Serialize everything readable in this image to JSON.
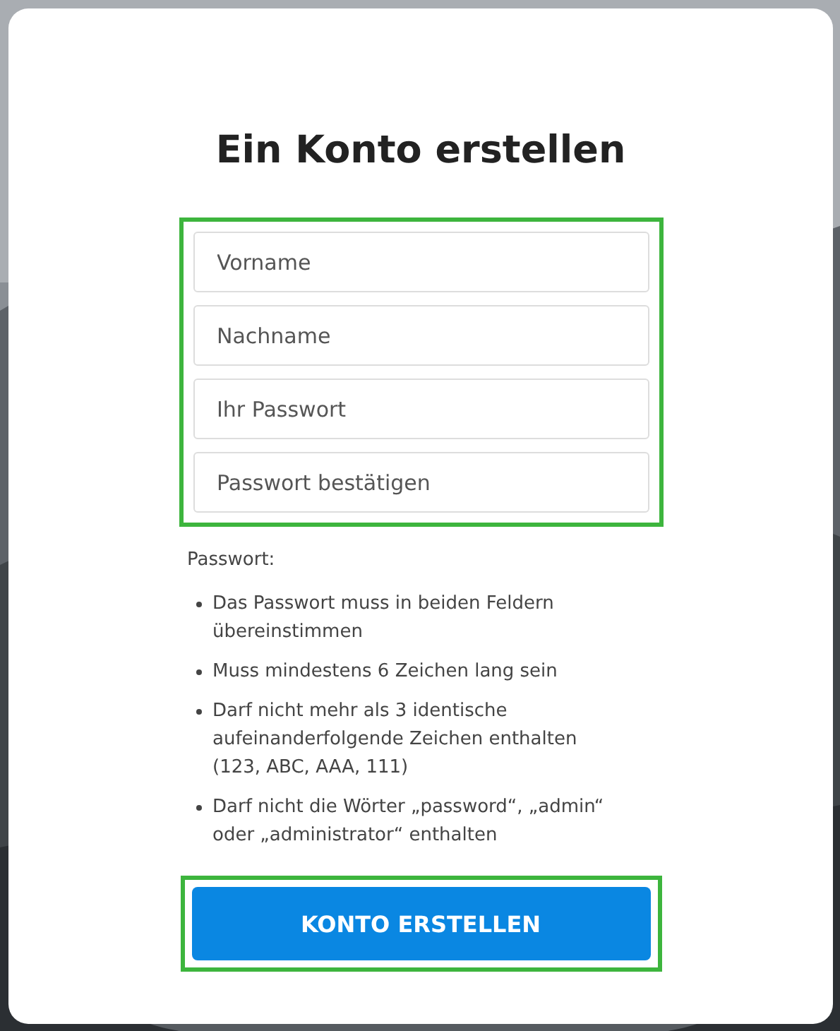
{
  "title": "Ein Konto erstellen",
  "fields_group": {
    "highlighted": true,
    "fields": [
      {
        "placeholder": "Vorname"
      },
      {
        "placeholder": "Nachname"
      },
      {
        "placeholder": "Ihr Passwort"
      },
      {
        "placeholder": "Passwort bestätigen"
      }
    ]
  },
  "password_rules": {
    "heading": "Passwort:",
    "items": [
      "Das Passwort muss in beiden Feldern übereinstimmen",
      "Muss mindestens 6 Zeichen lang sein",
      "Darf nicht mehr als 3 identische aufeinanderfolgende Zeichen enthalten (123, ABC, AAA, 111)",
      "Darf nicht die Wörter „password“, „admin“ oder „administrator“ enthalten"
    ]
  },
  "submit": {
    "highlighted": true,
    "label": "KONTO ERSTELLEN"
  }
}
